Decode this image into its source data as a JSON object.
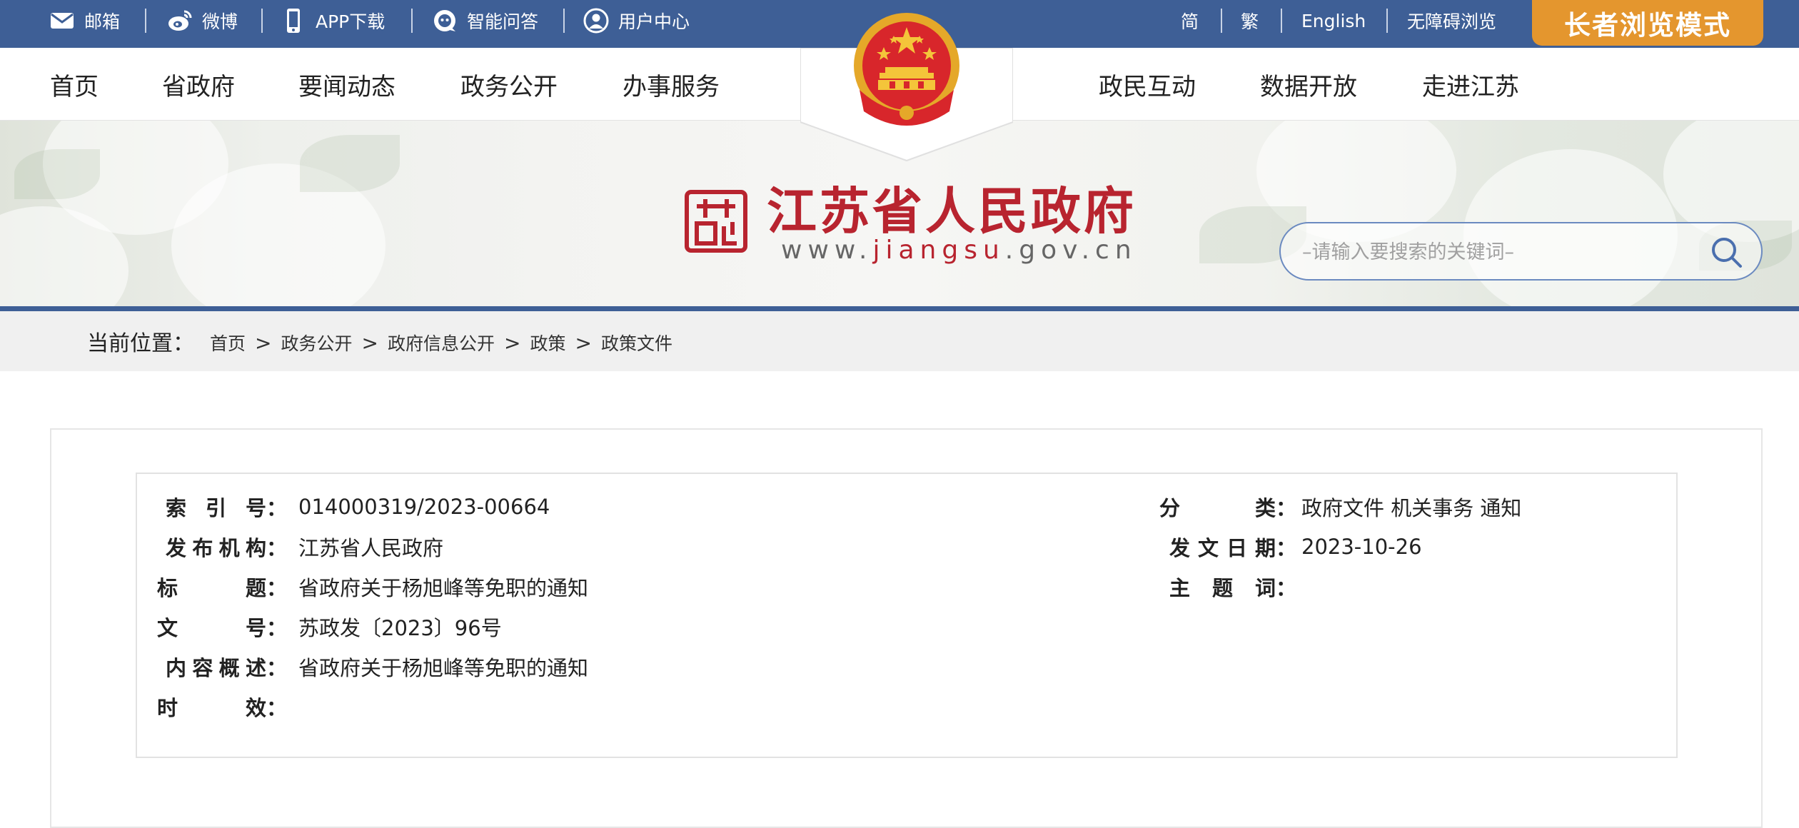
{
  "topbar": {
    "mail": "邮箱",
    "weibo": "微博",
    "app": "APP下载",
    "qa": "智能问答",
    "user": "用户中心",
    "simplified": "简",
    "traditional": "繁",
    "english": "English",
    "accessible": "无障碍浏览",
    "elder_mode": "长者浏览模式"
  },
  "nav": {
    "left": [
      "首页",
      "省政府",
      "要闻动态",
      "政务公开",
      "办事服务"
    ],
    "right": [
      "政民互动",
      "数据开放",
      "走进江苏"
    ]
  },
  "banner": {
    "site_title": "江苏省人民政府",
    "url_prefix": "www.",
    "url_mid": "jiangsu",
    "url_suffix": ".gov.cn",
    "search_placeholder": "–请输入要搜索的关键词–"
  },
  "breadcrumb": {
    "label": "当前位置：",
    "items": [
      "首页",
      "政务公开",
      "政府信息公开",
      "政策",
      "政策文件"
    ],
    "separator": ">"
  },
  "meta": {
    "index_no_label": [
      "索",
      "引",
      "号："
    ],
    "index_no": "014000319/2023-00664",
    "category_label": [
      "分",
      "类："
    ],
    "category": "政府文件 机关事务 通知",
    "issuer_label": [
      "发",
      "布",
      "机",
      "构："
    ],
    "issuer": "江苏省人民政府",
    "date_label": [
      "发",
      "文",
      "日",
      "期："
    ],
    "date": "2023-10-26",
    "title_label": [
      "标",
      "题："
    ],
    "title": "省政府关于杨旭峰等免职的通知",
    "subject_label": [
      "主",
      "题",
      "词："
    ],
    "subject": "",
    "doc_no_label": [
      "文",
      "号："
    ],
    "doc_no": "苏政发〔2023〕96号",
    "summary_label": [
      "内",
      "容",
      "概",
      "述："
    ],
    "summary": "省政府关于杨旭峰等免职的通知",
    "validity_label": [
      "时",
      "效："
    ],
    "validity": ""
  },
  "colors": {
    "topbar": "#3e5f96",
    "elder_button": "#e4962e",
    "title_red": "#b8242f",
    "crumb_bg": "#f0f0f0"
  }
}
